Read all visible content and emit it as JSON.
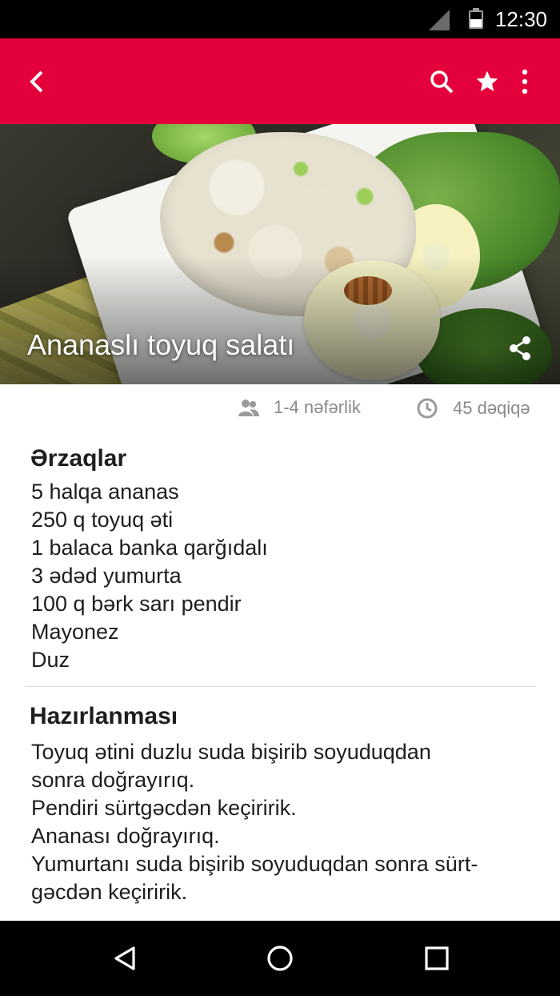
{
  "status_bar": {
    "time": "12:30"
  },
  "app_bar": {
    "color": "#e4003a",
    "icons": {
      "back": "back-arrow-icon",
      "search": "search-icon",
      "favorite": "star-icon",
      "more": "more-vert-icon"
    }
  },
  "recipe": {
    "title": "Ananaslı toyuq salatı",
    "servings": "1-4 nəfərlik",
    "duration": "45 dəqiqə"
  },
  "ingredients": {
    "title": "Ərzaqlar",
    "items": [
      "5 halqa ananas",
      "250 q toyuq əti",
      "1 balaca banka qarğıdalı",
      "3 ədəd yumurta",
      "100 q bərk sarı pendir",
      "Mayonez",
      "Duz"
    ]
  },
  "preparation": {
    "title": "Hazırlanması",
    "lines": [
      "Toyuq ətini duzlu suda bişirib soyuduqdan",
      "sonra doğrayırıq.",
      "Pendiri sürtgəcdən keçiririk.",
      "Ananası doğrayırıq.",
      "Yumurtanı suda bişirib soyuduqdan sonra sürt-",
      "gəcdən keçiririk."
    ]
  }
}
